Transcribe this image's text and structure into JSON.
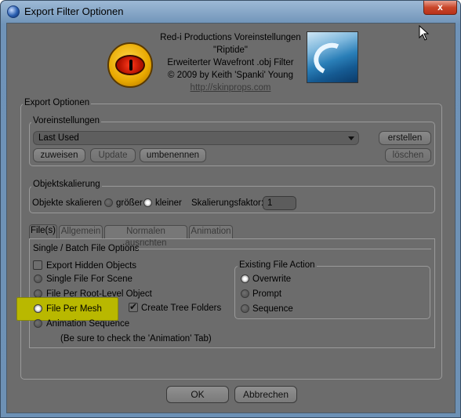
{
  "window": {
    "title": "Export Filter Optionen",
    "close_label": "x"
  },
  "header": {
    "line1": "Red-i Productions Voreinstellungen",
    "line2": "\"Riptide\"",
    "line3": "Erweiterter Wavefront .obj Filter",
    "line4": "© 2009 by Keith 'Spanki' Young",
    "link": "http://skinprops.com"
  },
  "export_options": {
    "label": "Export Optionen",
    "presets": {
      "label": "Voreinstellungen",
      "selected": "Last Used",
      "create_label": "erstellen",
      "assign_label": "zuweisen",
      "update_label": "Update",
      "rename_label": "umbenennen",
      "delete_label": "löschen"
    },
    "scaling": {
      "label": "Objektskalierung",
      "scale_label": "Objekte skalieren",
      "bigger_label": "größer",
      "smaller_label": "kleiner",
      "factor_label": "Skalierungsfaktor:",
      "factor_value": "1"
    }
  },
  "tabs": [
    {
      "label": "File(s)"
    },
    {
      "label": "Allgemein"
    },
    {
      "label": "Normalen ausrichten"
    },
    {
      "label": "Animation"
    }
  ],
  "files_tab": {
    "group_label": "Single / Batch  File Options",
    "export_hidden": "Export Hidden Objects",
    "single_file": "Single File For Scene",
    "per_root": "File Per Root-Level Object",
    "per_mesh": "File Per Mesh",
    "tree_folders": "Create Tree Folders",
    "animation_sequence": "Animation Sequence",
    "animation_note": "(Be sure to check the 'Animation' Tab)",
    "existing": {
      "label": "Existing File Action",
      "overwrite": "Overwrite",
      "prompt": "Prompt",
      "sequence": "Sequence"
    }
  },
  "footer": {
    "ok_label": "OK",
    "cancel_label": "Abbrechen"
  },
  "colors": {
    "dialog_bg": "#6c6c6c",
    "highlight": "#b9b800",
    "frame": "#6f93b8"
  }
}
